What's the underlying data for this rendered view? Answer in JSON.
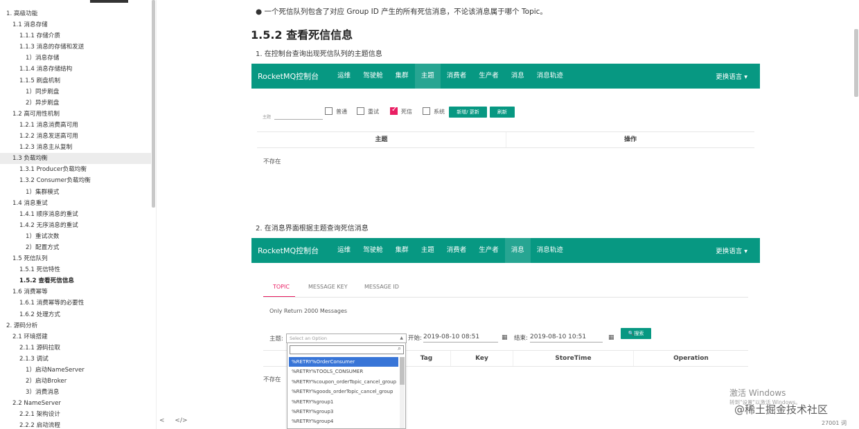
{
  "toc": {
    "items": [
      {
        "label": "1. 高级功能",
        "indent": 0
      },
      {
        "label": "1.1 消息存储",
        "indent": 1
      },
      {
        "label": "1.1.1 存储介质",
        "indent": 2
      },
      {
        "label": "1.1.3 消息的存储和发送",
        "indent": 2
      },
      {
        "label": "1）消息存储",
        "indent": 3
      },
      {
        "label": "1.1.4 消息存储结构",
        "indent": 2
      },
      {
        "label": "1.1.5 刷盘机制",
        "indent": 2
      },
      {
        "label": "1）同步刷盘",
        "indent": 3
      },
      {
        "label": "2）异步刷盘",
        "indent": 3
      },
      {
        "label": "1.2 高可用性机制",
        "indent": 1
      },
      {
        "label": "1.2.1 消息消费高可用",
        "indent": 2
      },
      {
        "label": "1.2.2 消息发送高可用",
        "indent": 2
      },
      {
        "label": "1.2.3 消息主从复制",
        "indent": 2
      },
      {
        "label": "1.3 负载均衡",
        "indent": 1,
        "highlight": true
      },
      {
        "label": "1.3.1 Producer负载均衡",
        "indent": 2
      },
      {
        "label": "1.3.2 Consumer负载均衡",
        "indent": 2
      },
      {
        "label": "1）集群模式",
        "indent": 3
      },
      {
        "label": "1.4 消息重试",
        "indent": 1
      },
      {
        "label": "1.4.1 顺序消息的重试",
        "indent": 2
      },
      {
        "label": "1.4.2 无序消息的重试",
        "indent": 2
      },
      {
        "label": "1）重试次数",
        "indent": 3
      },
      {
        "label": "2）配置方式",
        "indent": 3
      },
      {
        "label": "1.5 死信队列",
        "indent": 1
      },
      {
        "label": "1.5.1 死信特性",
        "indent": 2
      },
      {
        "label": "1.5.2 查看死信信息",
        "indent": 2,
        "active": true
      },
      {
        "label": "1.6 消费幂等",
        "indent": 1
      },
      {
        "label": "1.6.1 消费幂等的必要性",
        "indent": 2
      },
      {
        "label": "1.6.2 处理方式",
        "indent": 2
      },
      {
        "label": "2. 源码分析",
        "indent": 0
      },
      {
        "label": "2.1 环境搭建",
        "indent": 1
      },
      {
        "label": "2.1.1 源码拉取",
        "indent": 2
      },
      {
        "label": "2.1.3 调试",
        "indent": 2
      },
      {
        "label": "1）启动NameServer",
        "indent": 3
      },
      {
        "label": "2）启动Broker",
        "indent": 3
      },
      {
        "label": "3）消费消息",
        "indent": 3
      },
      {
        "label": "2.2 NameServer",
        "indent": 1
      },
      {
        "label": "2.2.1 架构设计",
        "indent": 2
      },
      {
        "label": "2.2.2 启动流程",
        "indent": 2
      }
    ],
    "footer_left": "<",
    "footer_code": "</>"
  },
  "doc": {
    "bullet": "一个死信队列包含了对应 Group ID 产生的所有死信消息，不论该消息属于哪个 Topic。",
    "heading": "1.5.2 查看死信信息",
    "step1": "1. 在控制台查询出现死信队列的主题信息",
    "step2": "2. 在消息界面根据主题查询死信消息"
  },
  "console1": {
    "brand": "RocketMQ控制台",
    "nav": [
      "运维",
      "驾驶舱",
      "集群",
      "主题",
      "消费者",
      "生产者",
      "消息",
      "消息轨迹"
    ],
    "lang": "更换语言 ▾",
    "filter_label": "主题",
    "checkboxes": [
      "普通",
      "重试",
      "死信",
      "系统"
    ],
    "btn_add": "新增/ 更新",
    "btn_refresh": "刷新",
    "col_topic": "主题",
    "col_op": "操作",
    "empty": "不存在"
  },
  "console2": {
    "brand": "RocketMQ控制台",
    "nav": [
      "运维",
      "驾驶舱",
      "集群",
      "主题",
      "消费者",
      "生产者",
      "消息",
      "消息轨迹"
    ],
    "lang": "更换语言 ▾",
    "tabs": [
      "TOPIC",
      "MESSAGE KEY",
      "MESSAGE ID"
    ],
    "note": "Only Return 2000 Messages",
    "topic_label": "主题:",
    "select_placeholder": "Select an Option",
    "start_label": "开始:",
    "start_value": "2019-08-10 08:51",
    "end_label": "结束:",
    "end_value": "2019-08-10 10:51",
    "search_btn": "🔍搜索",
    "cols": [
      "Tag",
      "Key",
      "StoreTime",
      "Operation"
    ],
    "empty": "不存在",
    "options": [
      "%RETRY%OrderConsumer",
      "%RETRY%TOOLS_CONSUMER",
      "%RETRY%coupon_orderTopic_cancel_group",
      "%RETRY%goods_orderTopic_cancel_group",
      "%RETRY%group1",
      "%RETRY%group3",
      "%RETRY%group4"
    ]
  },
  "overlay": {
    "activate": "激活 Windows",
    "activate_sub": "转到\"设置\"以激活 Windows。",
    "juejin": "@稀土掘金技术社区",
    "wordcount": "27001 词"
  }
}
